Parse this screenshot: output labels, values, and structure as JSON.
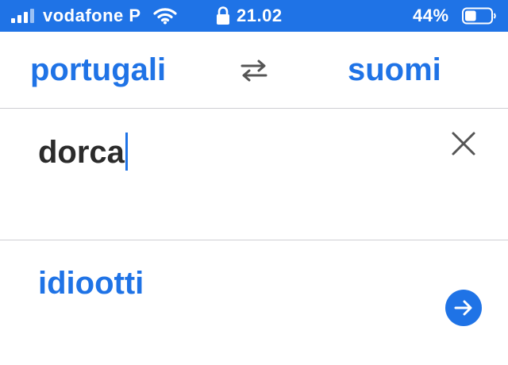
{
  "status_bar": {
    "carrier": "vodafone P",
    "time": "21.02",
    "battery_percent": "44%",
    "battery_level": 0.44,
    "icons": [
      "signal-icon",
      "wifi-icon",
      "lock-icon",
      "battery-icon"
    ]
  },
  "language_bar": {
    "source_language": "portugali",
    "target_language": "suomi",
    "swap_icon": "swap-arrows-icon"
  },
  "input": {
    "value": "dorca",
    "clear_icon": "close-icon"
  },
  "result": {
    "translation": "idiootti",
    "go_icon": "arrow-right-icon"
  },
  "colors": {
    "accent": "#1f73e6",
    "text": "#2b2b2b",
    "divider": "#cfcfd3",
    "icon_gray": "#555555"
  }
}
